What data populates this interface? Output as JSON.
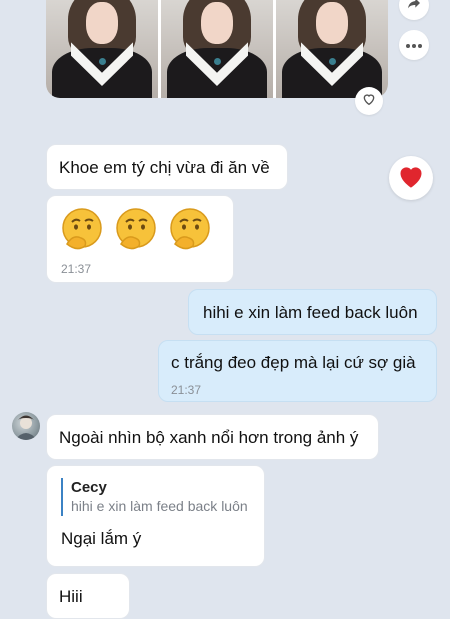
{
  "album": {
    "photos": [
      "photo-1",
      "photo-2",
      "photo-3"
    ]
  },
  "actions": {
    "share_icon": "share-icon",
    "more_icon": "more-icon",
    "react_icon": "heart-outline-icon"
  },
  "messages": [
    {
      "text": "Khoe em tý chị vừa đi ăn về",
      "direction": "in"
    },
    {
      "emojis": [
        "thinking-face-icon",
        "thinking-face-icon",
        "thinking-face-icon"
      ],
      "time": "21:37",
      "direction": "in"
    },
    {
      "text": "hihi e xin làm feed back luôn",
      "direction": "out"
    },
    {
      "text": "c trắng đeo đẹp mà lại cứ sợ già",
      "time": "21:37",
      "direction": "out"
    },
    {
      "text": "Ngoài nhìn bộ xanh nổi hơn trong ảnh ý",
      "direction": "in"
    },
    {
      "quote": {
        "name": "Cecy",
        "text": "hihi e xin làm feed back luôn"
      },
      "text": "Ngại lắm ý",
      "direction": "in"
    },
    {
      "text": "Hiii",
      "direction": "in"
    }
  ],
  "reaction": {
    "icon": "red-heart-icon",
    "color": "#e0262e"
  },
  "colors": {
    "background": "#dfe5ee",
    "incoming": "#ffffff",
    "outgoing": "#d8ecfb",
    "accent": "#3b82c4"
  }
}
